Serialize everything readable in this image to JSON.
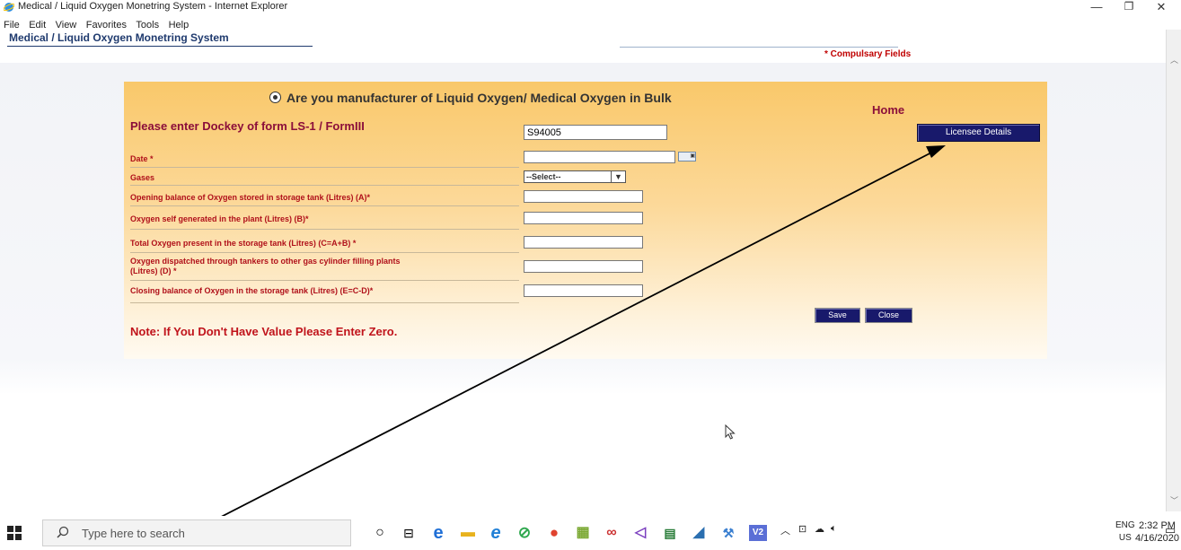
{
  "window": {
    "title": "Medical / Liquid Oxygen Monetring System - Internet Explorer",
    "minimize": "—",
    "restore": "❐",
    "close": "✕"
  },
  "menu": [
    "File",
    "Edit",
    "View",
    "Favorites",
    "Tools",
    "Help"
  ],
  "app": {
    "title": "Medical / Liquid Oxygen Monetring System",
    "compulsory": "* Compulsary Fields"
  },
  "form": {
    "question": "Are you manufacturer of Liquid Oxygen/ Medical Oxygen in Bulk",
    "home": "Home",
    "dockey_label": "Please enter Dockey of form LS-1 / FormIII",
    "dockey_value": "S94005",
    "licensee_button": "Licensee Details",
    "fields": {
      "date": "Date *",
      "gases": "Gases",
      "gases_selected": "--Select--",
      "opening": "Opening balance of Oxygen stored in storage tank (Litres) (A)*",
      "self_generated": "Oxygen self generated in the plant (Litres) (B)*",
      "total": "Total Oxygen present in the storage tank (Litres) (C=A+B) *",
      "dispatched_line1": "Oxygen dispatched through tankers to other gas cylinder filling plants",
      "dispatched_line2": "(Litres) (D) *",
      "closing": "Closing balance of Oxygen in the storage tank (Litres) (E=C-D)*"
    },
    "save_button": "Save",
    "close_button": "Close",
    "note": "Note: If You Don't Have Value Please Enter Zero."
  },
  "taskbar": {
    "search_placeholder": "Type here to search",
    "lang1": "ENG",
    "lang2": "US",
    "time": "2:32 PM",
    "date": "4/16/2020"
  }
}
